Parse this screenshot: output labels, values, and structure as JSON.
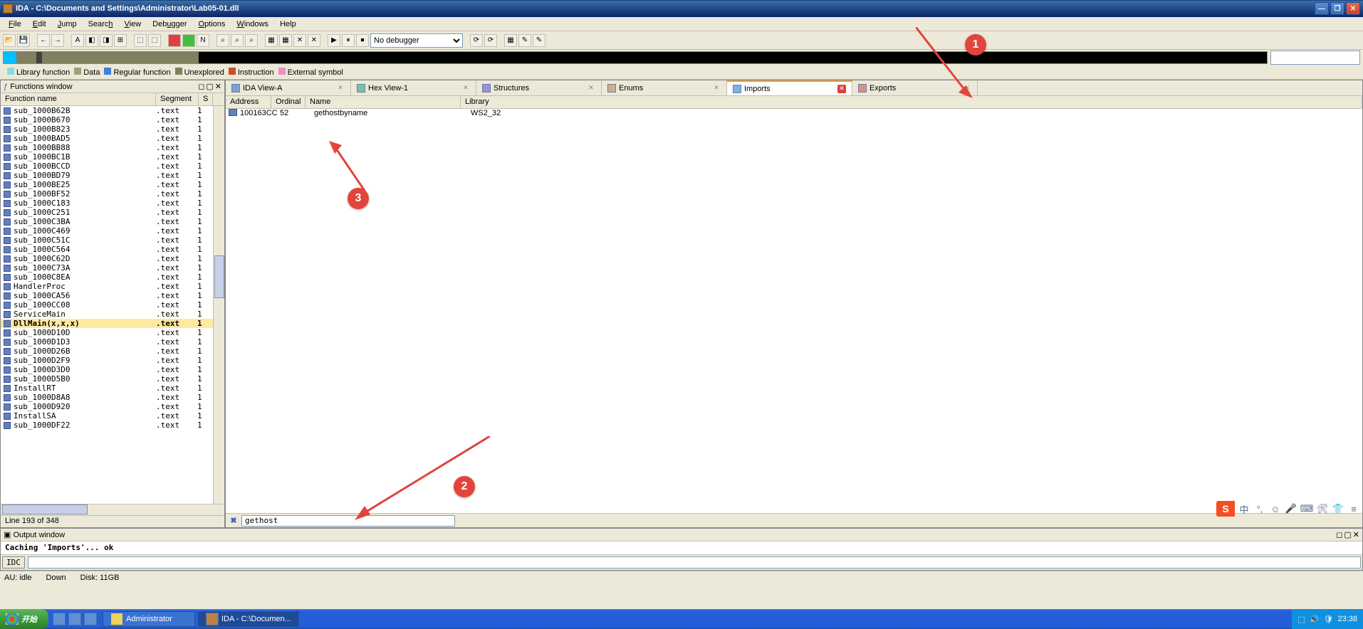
{
  "title": "IDA - C:\\Documents and Settings\\Administrator\\Lab05-01.dll",
  "menu": {
    "file": "File",
    "edit": "Edit",
    "jump": "Jump",
    "search": "Search",
    "view": "View",
    "debugger": "Debugger",
    "options": "Options",
    "windows": "Windows",
    "help": "Help"
  },
  "debugger_sel": "No debugger",
  "legend": {
    "lib": "Library function",
    "data": "Data",
    "reg": "Regular function",
    "unx": "Unexplored",
    "ins": "Instruction",
    "ext": "External symbol"
  },
  "fw_title": "Functions window",
  "fw_cols": {
    "name": "Function name",
    "seg": "Segment",
    "s": "S"
  },
  "funcs": [
    {
      "n": "sub_1000B62B",
      "s": ".text",
      "t": "1"
    },
    {
      "n": "sub_1000B670",
      "s": ".text",
      "t": "1"
    },
    {
      "n": "sub_1000B823",
      "s": ".text",
      "t": "1"
    },
    {
      "n": "sub_1000BAD5",
      "s": ".text",
      "t": "1"
    },
    {
      "n": "sub_1000BB88",
      "s": ".text",
      "t": "1"
    },
    {
      "n": "sub_1000BC1B",
      "s": ".text",
      "t": "1"
    },
    {
      "n": "sub_1000BCCD",
      "s": ".text",
      "t": "1"
    },
    {
      "n": "sub_1000BD79",
      "s": ".text",
      "t": "1"
    },
    {
      "n": "sub_1000BE25",
      "s": ".text",
      "t": "1"
    },
    {
      "n": "sub_1000BF52",
      "s": ".text",
      "t": "1"
    },
    {
      "n": "sub_1000C183",
      "s": ".text",
      "t": "1"
    },
    {
      "n": "sub_1000C251",
      "s": ".text",
      "t": "1"
    },
    {
      "n": "sub_1000C3BA",
      "s": ".text",
      "t": "1"
    },
    {
      "n": "sub_1000C469",
      "s": ".text",
      "t": "1"
    },
    {
      "n": "sub_1000C51C",
      "s": ".text",
      "t": "1"
    },
    {
      "n": "sub_1000C564",
      "s": ".text",
      "t": "1"
    },
    {
      "n": "sub_1000C62D",
      "s": ".text",
      "t": "1"
    },
    {
      "n": "sub_1000C73A",
      "s": ".text",
      "t": "1"
    },
    {
      "n": "sub_1000C8EA",
      "s": ".text",
      "t": "1"
    },
    {
      "n": "HandlerProc",
      "s": ".text",
      "t": "1"
    },
    {
      "n": "sub_1000CA56",
      "s": ".text",
      "t": "1"
    },
    {
      "n": "sub_1000CC08",
      "s": ".text",
      "t": "1"
    },
    {
      "n": "ServiceMain",
      "s": ".text",
      "t": "1"
    },
    {
      "n": "DllMain(x,x,x)",
      "s": ".text",
      "t": "1",
      "sel": true
    },
    {
      "n": "sub_1000D10D",
      "s": ".text",
      "t": "1"
    },
    {
      "n": "sub_1000D1D3",
      "s": ".text",
      "t": "1"
    },
    {
      "n": "sub_1000D26B",
      "s": ".text",
      "t": "1"
    },
    {
      "n": "sub_1000D2F9",
      "s": ".text",
      "t": "1"
    },
    {
      "n": "sub_1000D3D0",
      "s": ".text",
      "t": "1"
    },
    {
      "n": "sub_1000D5B0",
      "s": ".text",
      "t": "1"
    },
    {
      "n": "InstallRT",
      "s": ".text",
      "t": "1"
    },
    {
      "n": "sub_1000D8A8",
      "s": ".text",
      "t": "1"
    },
    {
      "n": "sub_1000D920",
      "s": ".text",
      "t": "1"
    },
    {
      "n": "InstallSA",
      "s": ".text",
      "t": "1"
    },
    {
      "n": "sub_1000DF22",
      "s": ".text",
      "t": "1"
    }
  ],
  "fw_status": "Line 193 of 348",
  "tabs": {
    "ida": "IDA View-A",
    "hex": "Hex View-1",
    "str": "Structures",
    "enu": "Enums",
    "imp": "Imports",
    "exp": "Exports"
  },
  "imp_cols": {
    "addr": "Address",
    "ord": "Ordinal",
    "name": "Name",
    "lib": "Library"
  },
  "imp_row": {
    "addr": "100163CC",
    "ord": "52",
    "name": "gethostbyname",
    "lib": "WS2_32"
  },
  "filter_val": "gethost",
  "out_title": "Output window",
  "out_text": "Caching 'Imports'... ok",
  "idc_label": "IDC",
  "status": {
    "au": "AU:  idle",
    "down": "Down",
    "disk": "Disk: 11GB"
  },
  "task": {
    "start": "开始",
    "admin": "Administrator",
    "ida": "IDA - C:\\Documen...",
    "time": "23:38"
  },
  "ime": {
    "cn": "中"
  },
  "annot": {
    "a1": "1",
    "a2": "2",
    "a3": "3"
  }
}
